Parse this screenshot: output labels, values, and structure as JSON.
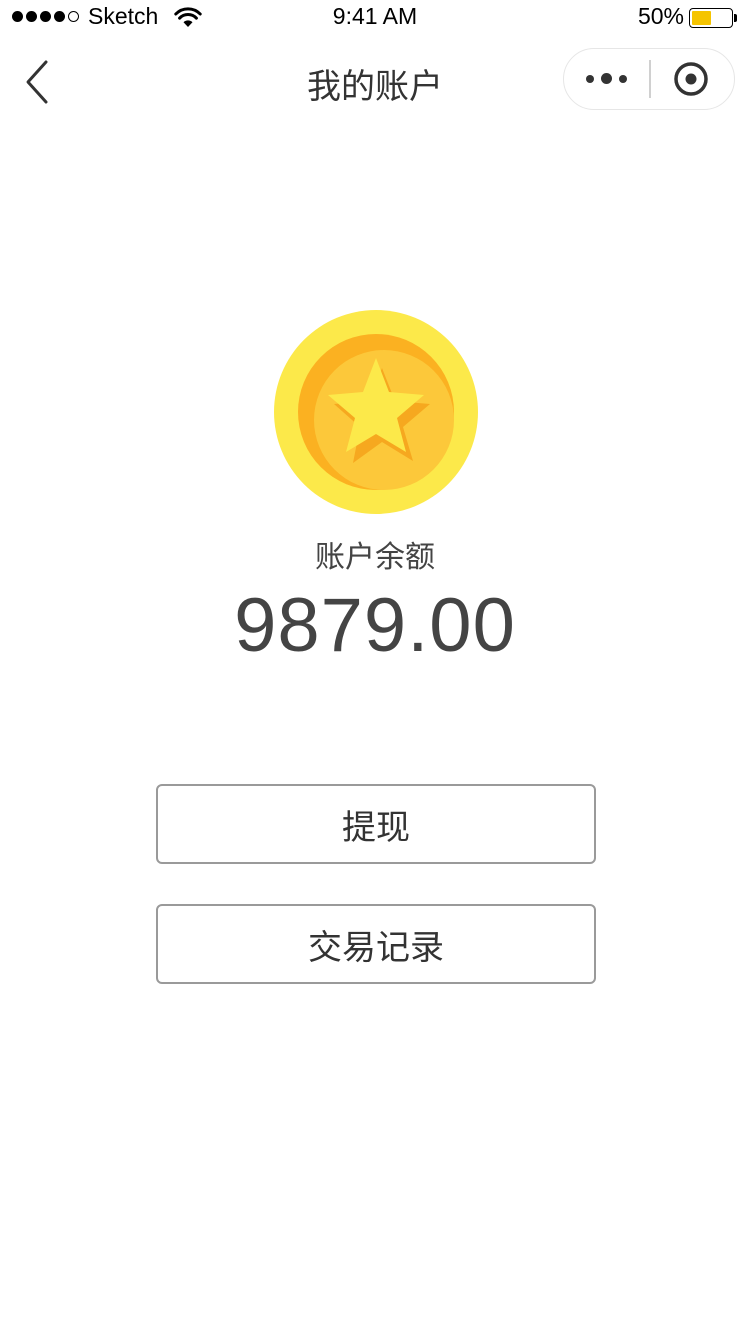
{
  "status_bar": {
    "carrier": "Sketch",
    "time": "9:41 AM",
    "battery_percent": "50%",
    "battery_level": 0.5,
    "battery_color": "#f5c400"
  },
  "nav": {
    "title": "我的账户",
    "back_icon": "chevron-left-icon",
    "more_icon": "more-dots-icon",
    "close_icon": "target-icon"
  },
  "account": {
    "coin_icon": "coin-star-icon",
    "balance_label": "账户余额",
    "balance_amount": "9879.00"
  },
  "actions": {
    "withdraw_label": "提现",
    "records_label": "交易记录"
  },
  "colors": {
    "coin_outer": "#fce94a",
    "coin_ring": "#fbb121",
    "coin_inner": "#fcc83a",
    "star": "#fce94a",
    "star_shadow": "#f6a81f",
    "text": "#333333"
  }
}
